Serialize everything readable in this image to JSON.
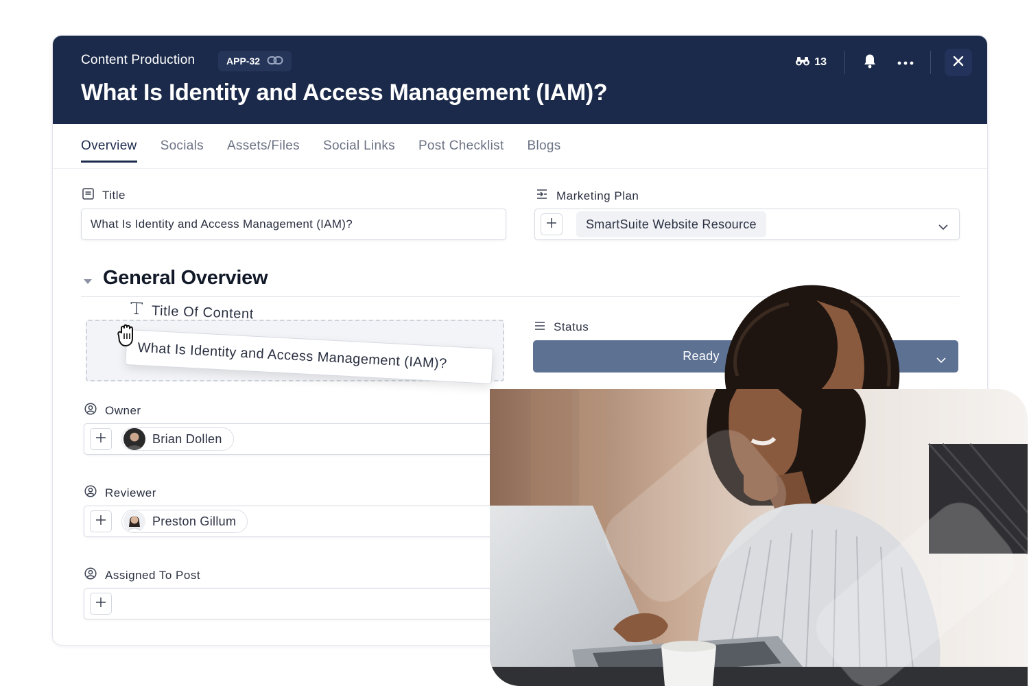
{
  "header": {
    "breadcrumb": "Content Production",
    "record_id": "APP-32",
    "title": "What Is Identity and Access Management (IAM)?",
    "watchers_count": "13",
    "icons": [
      "link-icon",
      "binoculars-icon",
      "bell-icon",
      "more-icon",
      "close-icon"
    ]
  },
  "tabs": [
    {
      "label": "Overview",
      "active": true
    },
    {
      "label": "Socials",
      "active": false
    },
    {
      "label": "Assets/Files",
      "active": false
    },
    {
      "label": "Social Links",
      "active": false
    },
    {
      "label": "Post Checklist",
      "active": false
    },
    {
      "label": "Blogs",
      "active": false
    }
  ],
  "fields": {
    "title": {
      "label": "Title",
      "value": "What Is Identity and Access Management (IAM)?"
    },
    "marketing_plan": {
      "label": "Marketing Plan",
      "value": "SmartSuite Website Resource"
    },
    "section_title": "General Overview",
    "title_of_content": {
      "label": "Title Of Content",
      "value": "What Is Identity and Access Management (IAM)?"
    },
    "status": {
      "label": "Status",
      "value": "Ready"
    },
    "owner": {
      "label": "Owner",
      "value": "Brian Dollen"
    },
    "reviewer": {
      "label": "Reviewer",
      "value": "Preston Gillum"
    },
    "assigned_to_post": {
      "label": "Assigned To Post",
      "value": ""
    }
  },
  "colors": {
    "header_bg": "#1b2a4a",
    "status_bg": "#5d7193",
    "active_tab": "#1b2a4a"
  }
}
